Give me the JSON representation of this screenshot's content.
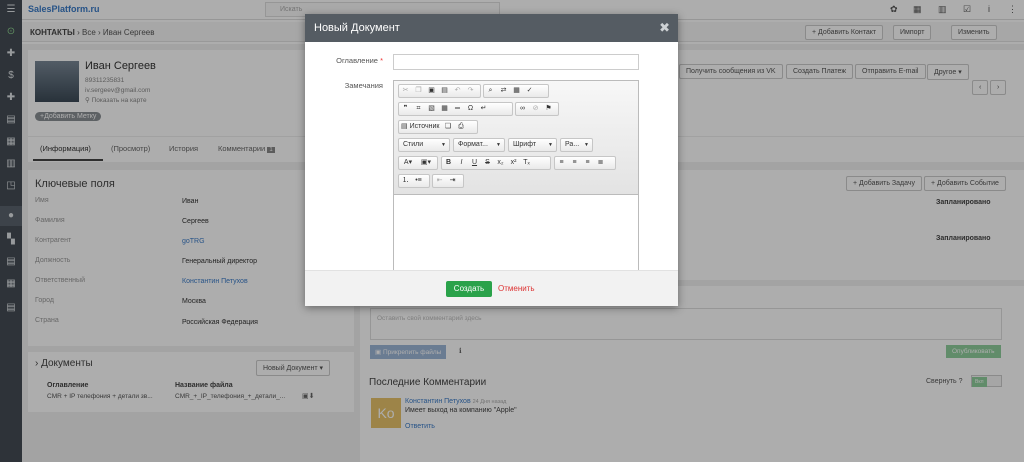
{
  "app": {
    "logo": "SalesPlatform.ru",
    "search_placeholder": "Искать"
  },
  "breadcrumb": {
    "module": "КОНТАКТЫ",
    "sep1": "›",
    "all": "Все",
    "sep2": "›",
    "record": "Иван Сергеев"
  },
  "header_actions": {
    "add_contact": "+ Добавить Контакт",
    "import": "Импорт",
    "edit": "Изменить"
  },
  "contact": {
    "name": "Иван Сергеев",
    "phone": "89311235831",
    "email": "iv.sergeev@gmail.com",
    "map_link": "Показать на карте",
    "add_tag": "+Добавить Метку"
  },
  "action_buttons": {
    "vk": "Получить сообщения из VK",
    "payment": "Создать Платеж",
    "email": "Отправить E-mail",
    "other": "Другое"
  },
  "tabs": {
    "info": "(Информация)",
    "view": "(Просмотр)",
    "history": "История",
    "comments": "Комментарии",
    "comments_count": "1"
  },
  "key_fields": {
    "title": "Ключевые поля",
    "rows": [
      {
        "label": "Имя",
        "value": "Иван"
      },
      {
        "label": "Фамилия",
        "value": "Сергеев"
      },
      {
        "label": "Контрагент",
        "value": "goTRG"
      },
      {
        "label": "Должность",
        "value": "Генеральный директор"
      },
      {
        "label": "Ответственный",
        "value": "Константин Петухов"
      },
      {
        "label": "Город",
        "value": "Москва"
      },
      {
        "label": "Страна",
        "value": "Российская Федерация"
      }
    ]
  },
  "documents": {
    "title": "Документы",
    "new_button": "Новый Документ",
    "col_title": "Оглавление",
    "col_file": "Название файла",
    "row_title": "CMR + IP телефония + детали зв...",
    "row_file": "CMR_+_IP_телефония_+_детали_..."
  },
  "activities": {
    "add_task": "+ Добавить Задачу",
    "add_event": "+ Добавить Событие",
    "status1": "Запланировано",
    "status2": "Запланировано"
  },
  "comment_box": {
    "placeholder": "Оставить свой комментарий здесь",
    "attach": "Прикрепить файлы",
    "publish": "Опубликовать"
  },
  "recent_comments": {
    "title": "Последние Комментарии",
    "collapse": "Свернуть",
    "toggle": "Вкл",
    "avatar": "Ko",
    "author": "Константин Петухов",
    "ago": "24 Дня назад",
    "text": "Имеет выход на компанию \"Apple\"",
    "reply": "Ответить"
  },
  "modal": {
    "title": "Новый Документ",
    "field_title": "Оглавление",
    "required_mark": "*",
    "field_notes": "Замечания",
    "source_label": "Источник",
    "styles": "Стили",
    "format": "Формат...",
    "font": "Шрифт",
    "size": "Ра...",
    "create": "Создать",
    "cancel": "Отменить"
  }
}
